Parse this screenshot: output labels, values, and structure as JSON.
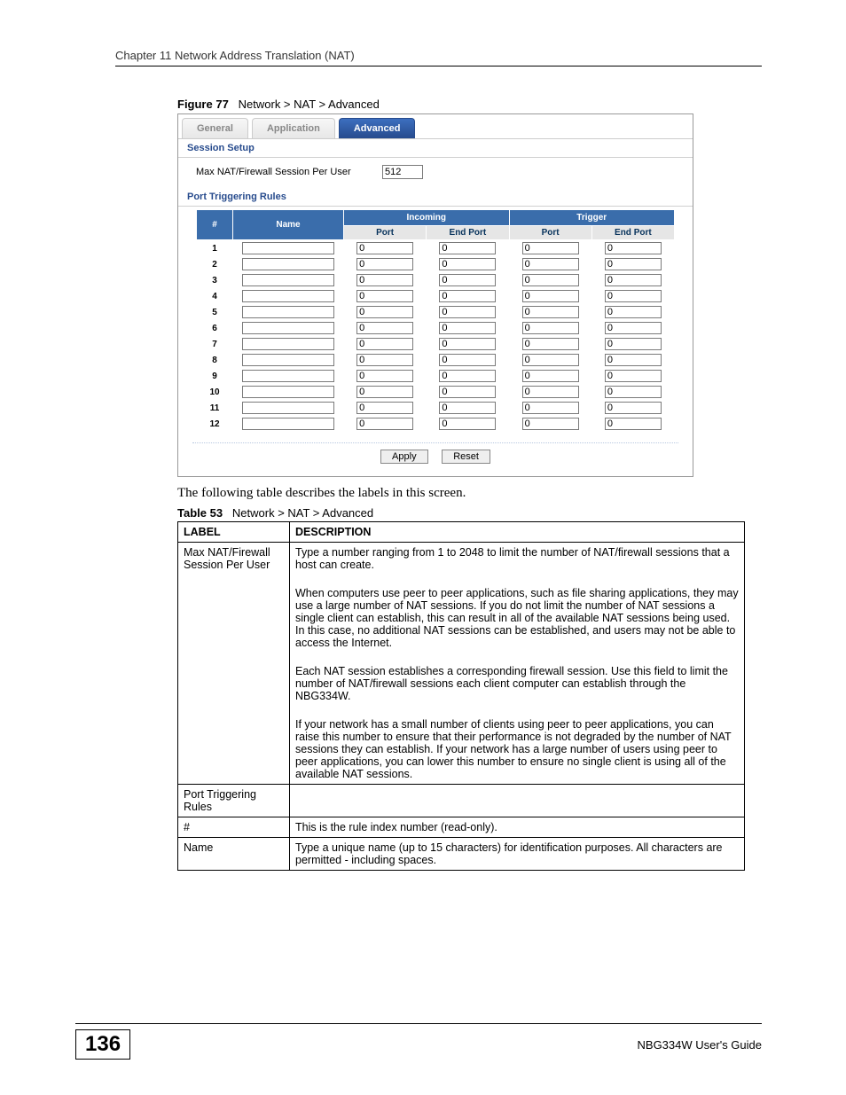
{
  "header": {
    "chapter": "Chapter 11 Network Address Translation (NAT)"
  },
  "figure": {
    "label": "Figure 77",
    "title": "Network > NAT > Advanced"
  },
  "ui": {
    "tabs": {
      "general": "General",
      "application": "Application",
      "advanced": "Advanced"
    },
    "session_setup_title": "Session Setup",
    "max_session_label": "Max NAT/Firewall Session Per User",
    "max_session_value": "512",
    "port_trigger_title": "Port Triggering Rules",
    "headers": {
      "num": "#",
      "name": "Name",
      "incoming": "Incoming",
      "trigger": "Trigger",
      "port": "Port",
      "end_port": "End Port"
    },
    "rows": [
      {
        "idx": "1",
        "name": "",
        "in_port": "0",
        "in_end": "0",
        "tr_port": "0",
        "tr_end": "0"
      },
      {
        "idx": "2",
        "name": "",
        "in_port": "0",
        "in_end": "0",
        "tr_port": "0",
        "tr_end": "0"
      },
      {
        "idx": "3",
        "name": "",
        "in_port": "0",
        "in_end": "0",
        "tr_port": "0",
        "tr_end": "0"
      },
      {
        "idx": "4",
        "name": "",
        "in_port": "0",
        "in_end": "0",
        "tr_port": "0",
        "tr_end": "0"
      },
      {
        "idx": "5",
        "name": "",
        "in_port": "0",
        "in_end": "0",
        "tr_port": "0",
        "tr_end": "0"
      },
      {
        "idx": "6",
        "name": "",
        "in_port": "0",
        "in_end": "0",
        "tr_port": "0",
        "tr_end": "0"
      },
      {
        "idx": "7",
        "name": "",
        "in_port": "0",
        "in_end": "0",
        "tr_port": "0",
        "tr_end": "0"
      },
      {
        "idx": "8",
        "name": "",
        "in_port": "0",
        "in_end": "0",
        "tr_port": "0",
        "tr_end": "0"
      },
      {
        "idx": "9",
        "name": "",
        "in_port": "0",
        "in_end": "0",
        "tr_port": "0",
        "tr_end": "0"
      },
      {
        "idx": "10",
        "name": "",
        "in_port": "0",
        "in_end": "0",
        "tr_port": "0",
        "tr_end": "0"
      },
      {
        "idx": "11",
        "name": "",
        "in_port": "0",
        "in_end": "0",
        "tr_port": "0",
        "tr_end": "0"
      },
      {
        "idx": "12",
        "name": "",
        "in_port": "0",
        "in_end": "0",
        "tr_port": "0",
        "tr_end": "0"
      }
    ],
    "apply": "Apply",
    "reset": "Reset"
  },
  "body_text": "The following table describes the labels in this screen.",
  "table_caption": {
    "label": "Table 53",
    "title": "Network > NAT > Advanced"
  },
  "desc_table": {
    "headers": {
      "label": "LABEL",
      "desc": "DESCRIPTION"
    },
    "rows": [
      {
        "label": "Max NAT/Firewall Session Per User",
        "desc": "Type a number ranging from 1 to 2048 to limit the number of NAT/firewall sessions that a host can create.\nWhen computers use peer to peer applications, such as file sharing applications, they may use a large number of NAT sessions. If you do not limit the number of NAT sessions a single client can establish, this can result in all of the available NAT sessions being used. In this case, no additional NAT sessions can be established, and users may not be able to access the Internet.\nEach NAT session establishes a corresponding firewall session. Use this field to limit the number of NAT/firewall sessions each client computer can establish through the NBG334W.\nIf your network has a small number of clients using peer to peer applications, you can raise this number to ensure that their performance is not degraded by the number of NAT sessions they can establish. If your network has a large number of users using peer to peer applications, you can lower this number to ensure no single client is using all of the available NAT sessions."
      },
      {
        "label": "Port Triggering Rules",
        "desc": ""
      },
      {
        "label": "#",
        "desc": "This is the rule index number (read-only)."
      },
      {
        "label": "Name",
        "desc": "Type a unique name (up to 15 characters) for identification purposes. All characters are permitted - including spaces."
      }
    ]
  },
  "footer": {
    "page": "136",
    "guide": "NBG334W User's Guide"
  }
}
